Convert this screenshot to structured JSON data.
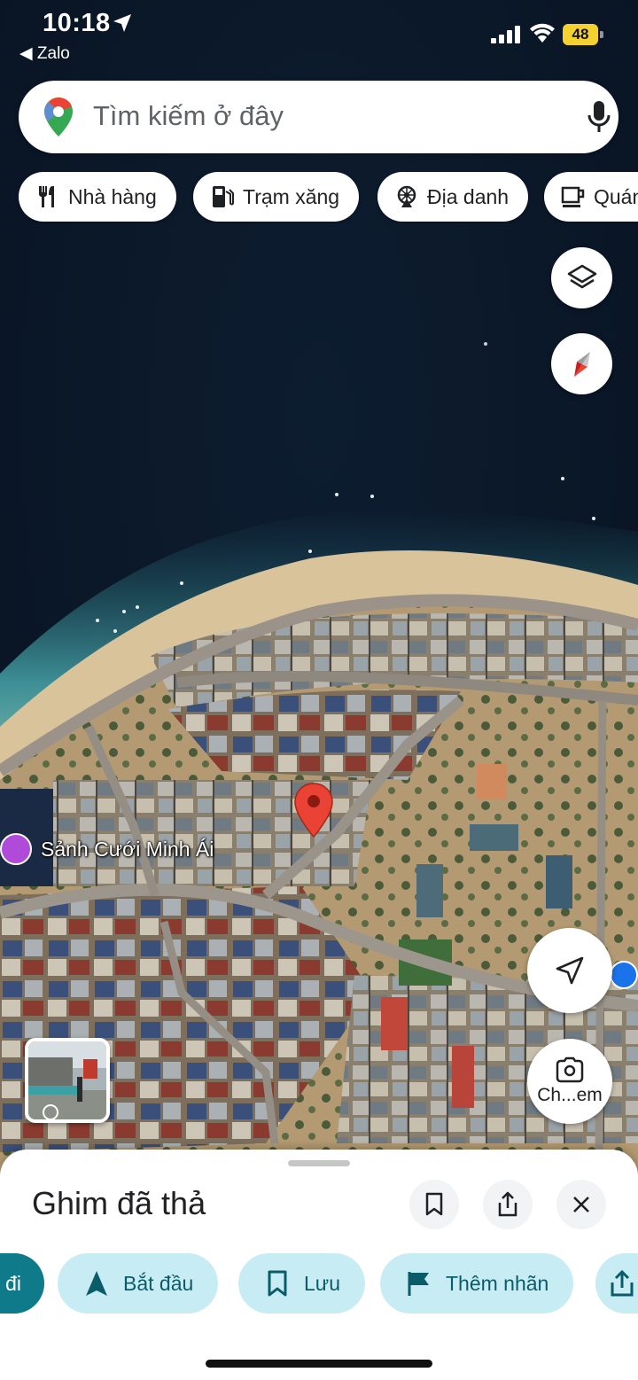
{
  "status_bar": {
    "time": "10:18",
    "back_app": "◀ Zalo",
    "battery": "48"
  },
  "search": {
    "placeholder": "Tìm kiếm ở đây"
  },
  "chips": [
    {
      "label": "Nhà hàng",
      "icon": "fork-knife-icon"
    },
    {
      "label": "Trạm xăng",
      "icon": "gas-station-icon"
    },
    {
      "label": "Địa danh",
      "icon": "landmark-icon"
    },
    {
      "label": "Quán cà phê",
      "icon": "coffee-icon"
    }
  ],
  "map": {
    "poi_label": "Sảnh Cưới Minh Ái",
    "lens_label": "Ch...em",
    "pin_color": "#ea4335"
  },
  "sheet": {
    "title": "Ghim đã thả",
    "actions": [
      {
        "label": "đi",
        "icon": "car-icon"
      },
      {
        "label": "Bắt đầu",
        "icon": "navigation-arrow-icon"
      },
      {
        "label": "Lưu",
        "icon": "bookmark-icon"
      },
      {
        "label": "Thêm nhãn",
        "icon": "flag-icon"
      },
      {
        "label": "",
        "icon": "share-icon"
      }
    ]
  },
  "colors": {
    "action_bg": "#c8ecf3",
    "action_primary": "#0e7a8a",
    "battery": "#f5d130"
  }
}
